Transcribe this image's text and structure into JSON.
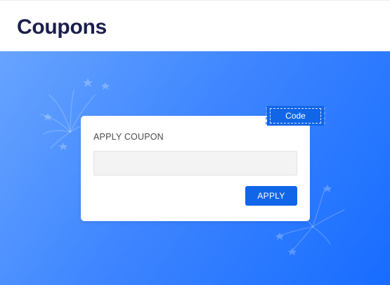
{
  "header": {
    "title": "Coupons"
  },
  "coupon_card": {
    "title": "APPLY COUPON",
    "input_value": "",
    "input_placeholder": "",
    "apply_label": "APPLY"
  },
  "code_tag": {
    "label": "Code"
  },
  "colors": {
    "title": "#1b1f4b",
    "banner_start": "#67a4ff",
    "banner_end": "#176cff",
    "accent": "#1166e8"
  },
  "icons": [
    "fireworks-decoration-icon",
    "star-icon"
  ]
}
